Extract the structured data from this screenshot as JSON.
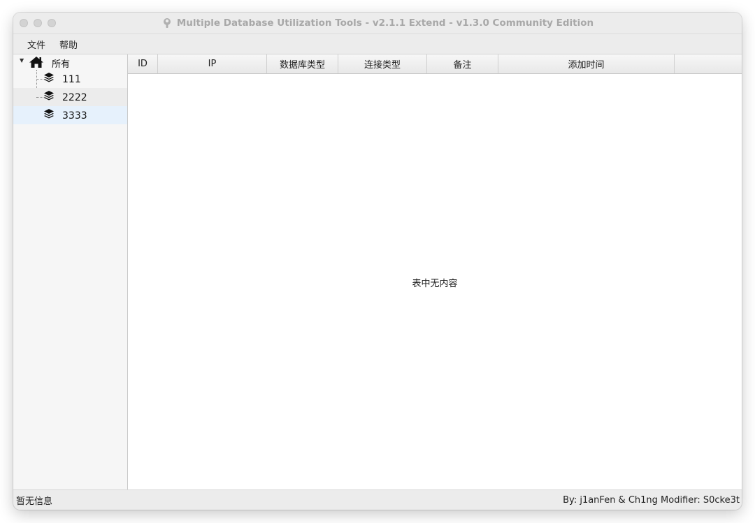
{
  "window": {
    "title": "Multiple Database Utilization Tools - v2.1.1 Extend - v1.3.0 Community Edition",
    "title_icon": "wrench-icon"
  },
  "menu": {
    "items": [
      "文件",
      "帮助"
    ]
  },
  "tree": {
    "root": {
      "label": "所有",
      "icon": "home-icon",
      "expanded": true
    },
    "children": [
      {
        "label": "111",
        "icon": "layers-icon"
      },
      {
        "label": "2222",
        "icon": "layers-icon"
      },
      {
        "label": "3333",
        "icon": "layers-icon"
      }
    ]
  },
  "table": {
    "columns": [
      "ID",
      "IP",
      "数据库类型",
      "连接类型",
      "备注",
      "添加时间"
    ],
    "rows": [],
    "empty_text": "表中无内容"
  },
  "status": {
    "left": "暂无信息",
    "right": "By: j1anFen & Ch1ng Modifier: S0cke3t"
  },
  "colors": {
    "selected_row": "#e6f1fc",
    "hover_row": "#ececec",
    "title_text": "#a8a8a8"
  }
}
